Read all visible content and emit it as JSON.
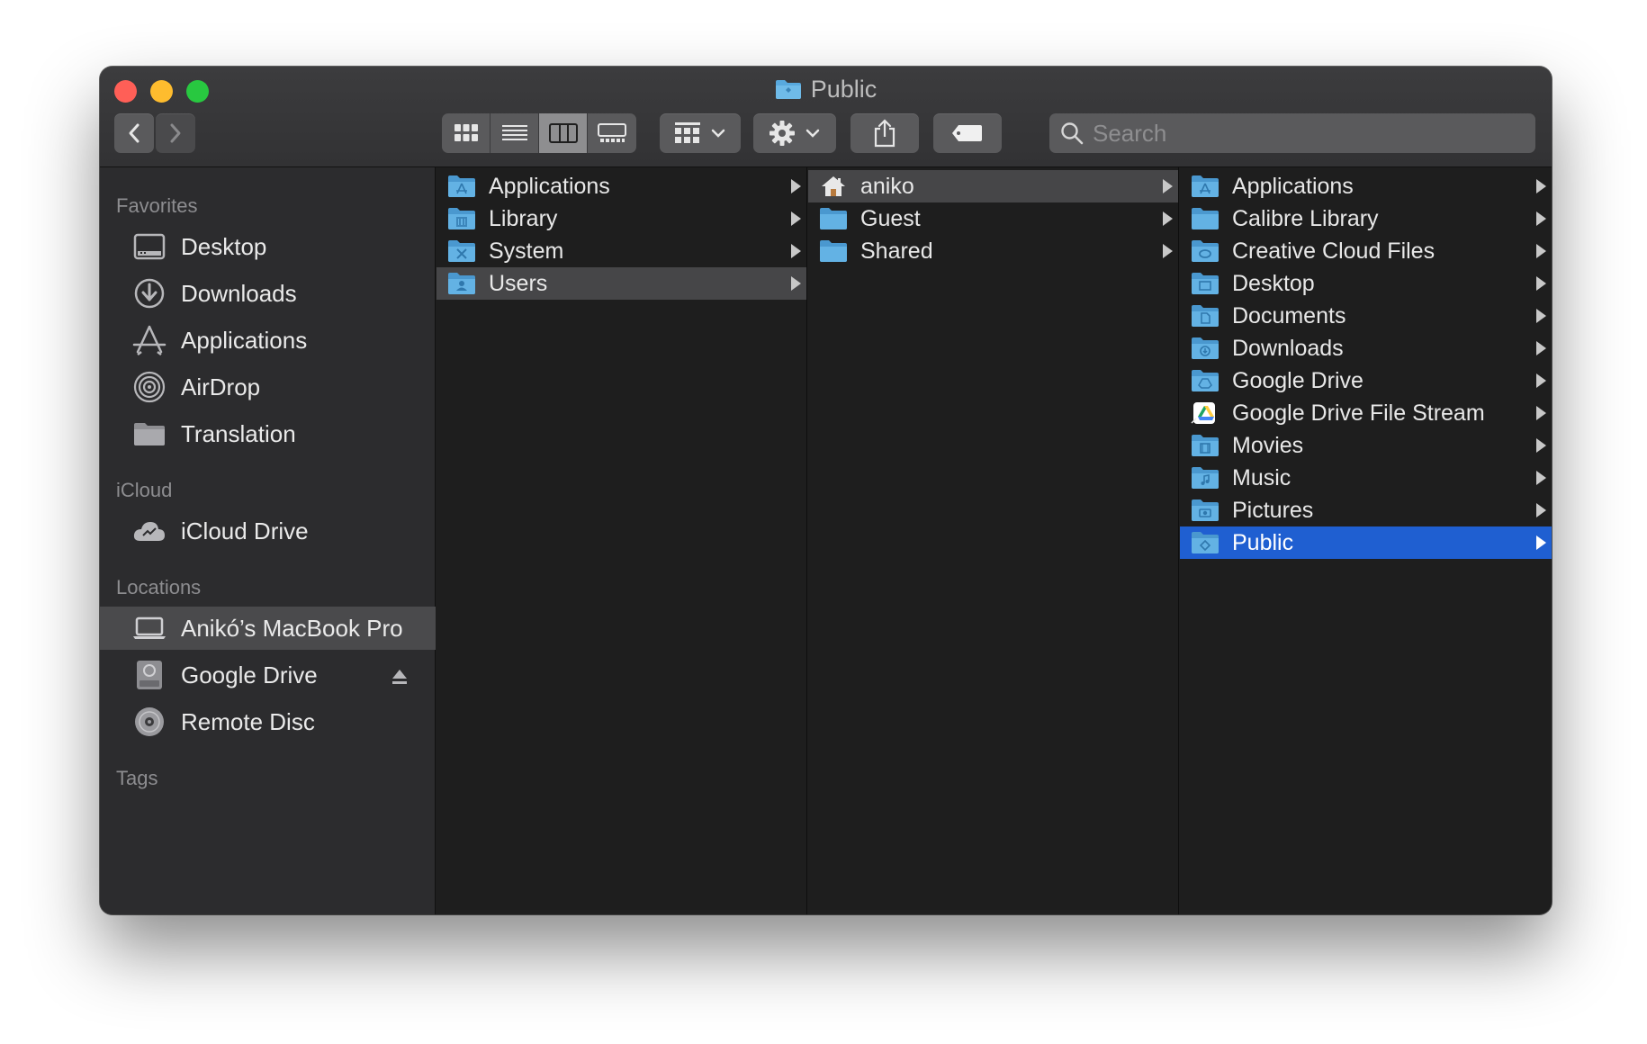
{
  "window": {
    "title": "Public"
  },
  "toolbar": {
    "search_placeholder": "Search",
    "view_modes": [
      "icon-view",
      "list-view",
      "column-view",
      "gallery-view"
    ],
    "active_view": "column-view"
  },
  "sidebar": {
    "favorites_heading": "Favorites",
    "favorites": [
      {
        "label": "Desktop",
        "icon": "desktop-icon"
      },
      {
        "label": "Downloads",
        "icon": "downloads-icon"
      },
      {
        "label": "Applications",
        "icon": "applications-icon"
      },
      {
        "label": "AirDrop",
        "icon": "airdrop-icon"
      },
      {
        "label": "Translation",
        "icon": "folder-icon"
      }
    ],
    "icloud_heading": "iCloud",
    "icloud": [
      {
        "label": "iCloud Drive",
        "icon": "icloud-icon"
      }
    ],
    "locations_heading": "Locations",
    "locations": [
      {
        "label": "Anikó’s MacBook Pro",
        "icon": "laptop-icon",
        "selected": true
      },
      {
        "label": "Google Drive",
        "icon": "drive-disk-icon"
      },
      {
        "label": "Remote Disc",
        "icon": "disc-icon"
      }
    ],
    "tags_heading": "Tags"
  },
  "columns": {
    "col1": [
      {
        "label": "Applications"
      },
      {
        "label": "Library"
      },
      {
        "label": "System"
      },
      {
        "label": "Users",
        "selected": true
      }
    ],
    "col2": [
      {
        "label": "aniko",
        "selected": true
      },
      {
        "label": "Guest"
      },
      {
        "label": "Shared"
      }
    ],
    "col3": [
      {
        "label": "Applications"
      },
      {
        "label": "Calibre Library"
      },
      {
        "label": "Creative Cloud Files"
      },
      {
        "label": "Desktop"
      },
      {
        "label": "Documents"
      },
      {
        "label": "Downloads"
      },
      {
        "label": "Google Drive"
      },
      {
        "label": "Google Drive File Stream"
      },
      {
        "label": "Movies"
      },
      {
        "label": "Music"
      },
      {
        "label": "Pictures"
      },
      {
        "label": "Public",
        "selected": true
      }
    ]
  },
  "colors": {
    "selection_blue": "#1f5fd1",
    "folder_blue": "#58a9de",
    "close": "#ff5f57",
    "minimize": "#febc2e",
    "maximize": "#28c840"
  }
}
